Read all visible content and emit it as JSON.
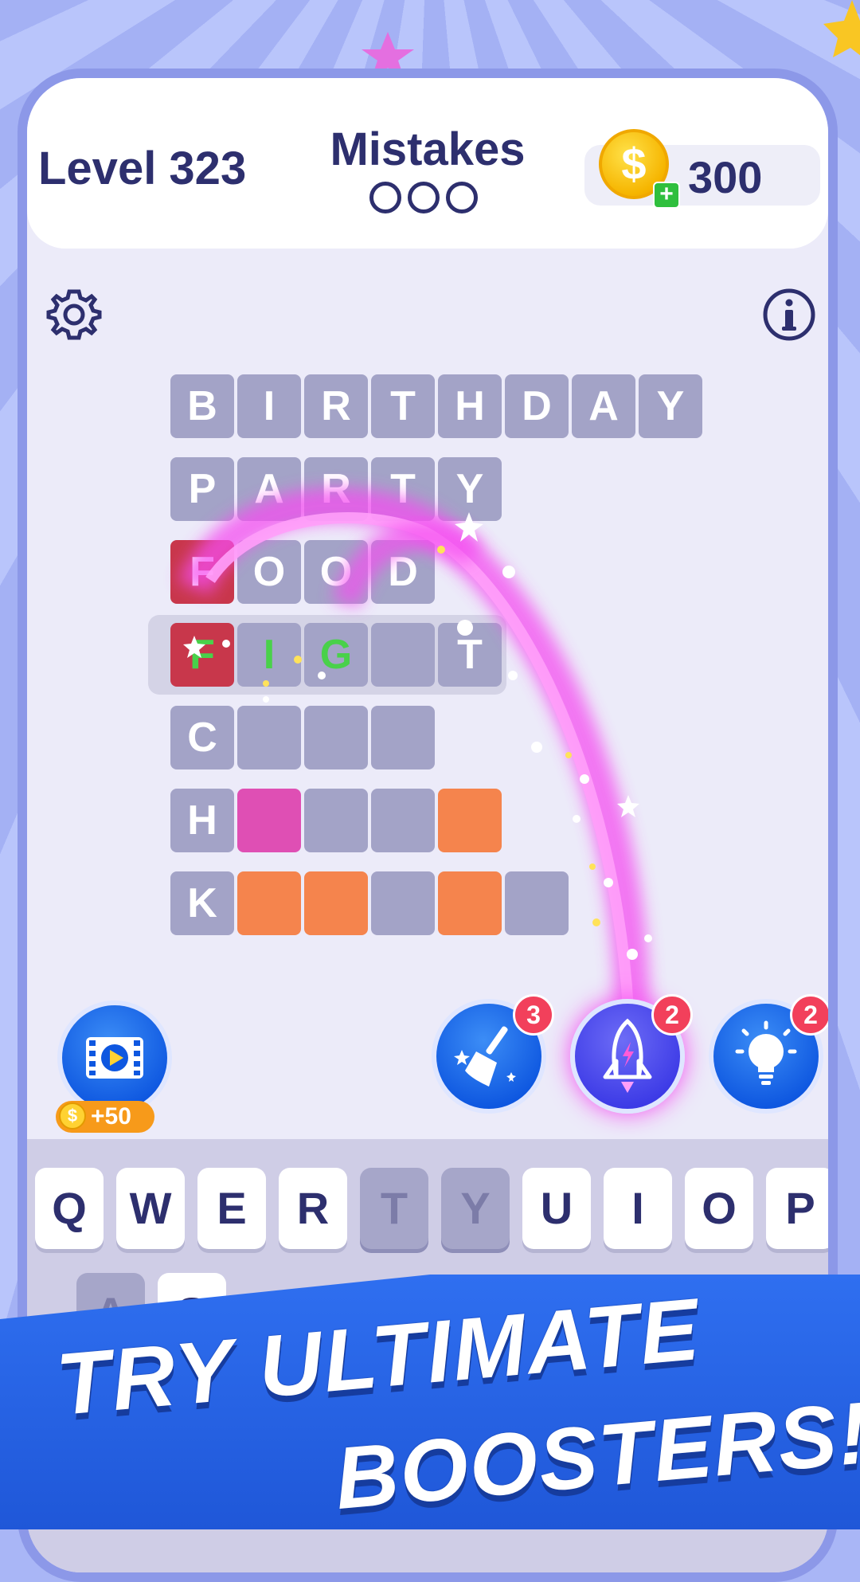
{
  "header": {
    "level_label": "Level 323",
    "mistakes_title": "Mistakes",
    "mistakes_used": 0,
    "mistakes_total": 3,
    "coins": "300",
    "coin_symbol": "$",
    "add_coins_symbol": "+"
  },
  "toolbar": {
    "settings_icon": "gear-icon",
    "info_icon": "info-icon"
  },
  "board": {
    "rows": [
      {
        "tiles": [
          {
            "letter": "B",
            "state": "revealed"
          },
          {
            "letter": "I",
            "state": "revealed"
          },
          {
            "letter": "R",
            "state": "revealed"
          },
          {
            "letter": "T",
            "state": "revealed"
          },
          {
            "letter": "H",
            "state": "revealed"
          },
          {
            "letter": "D",
            "state": "revealed"
          },
          {
            "letter": "A",
            "state": "revealed"
          },
          {
            "letter": "Y",
            "state": "revealed"
          }
        ]
      },
      {
        "tiles": [
          {
            "letter": "P",
            "state": "revealed"
          },
          {
            "letter": "A",
            "state": "revealed"
          },
          {
            "letter": "R",
            "state": "revealed"
          },
          {
            "letter": "T",
            "state": "revealed"
          },
          {
            "letter": "Y",
            "state": "revealed"
          }
        ]
      },
      {
        "tiles": [
          {
            "letter": "F",
            "state": "red"
          },
          {
            "letter": "O",
            "state": "revealed"
          },
          {
            "letter": "O",
            "state": "revealed"
          },
          {
            "letter": "D",
            "state": "revealed"
          }
        ]
      },
      {
        "active": true,
        "tiles": [
          {
            "letter": "F",
            "state": "red-green"
          },
          {
            "letter": "I",
            "state": "green"
          },
          {
            "letter": "G",
            "state": "green"
          },
          {
            "letter": "",
            "state": "empty"
          },
          {
            "letter": "T",
            "state": "revealed"
          }
        ]
      },
      {
        "tiles": [
          {
            "letter": "C",
            "state": "revealed"
          },
          {
            "letter": "",
            "state": "empty"
          },
          {
            "letter": "",
            "state": "empty"
          },
          {
            "letter": "",
            "state": "empty"
          }
        ]
      },
      {
        "tiles": [
          {
            "letter": "H",
            "state": "revealed"
          },
          {
            "letter": "",
            "state": "pink"
          },
          {
            "letter": "",
            "state": "empty"
          },
          {
            "letter": "",
            "state": "empty"
          },
          {
            "letter": "",
            "state": "orange"
          }
        ]
      },
      {
        "tiles": [
          {
            "letter": "K",
            "state": "revealed"
          },
          {
            "letter": "",
            "state": "orange"
          },
          {
            "letter": "",
            "state": "orange"
          },
          {
            "letter": "",
            "state": "empty"
          },
          {
            "letter": "",
            "state": "orange"
          },
          {
            "letter": "",
            "state": "empty"
          }
        ]
      }
    ]
  },
  "boosters": {
    "video_reward": {
      "icon": "video-film-icon",
      "reward": "+50"
    },
    "sweep": {
      "icon": "broom-icon",
      "count": "3"
    },
    "rocket": {
      "icon": "rocket-icon",
      "count": "2"
    },
    "hint": {
      "icon": "lightbulb-icon",
      "count": "2"
    }
  },
  "keyboard": {
    "row1": [
      {
        "key": "Q",
        "used": false
      },
      {
        "key": "W",
        "used": false
      },
      {
        "key": "E",
        "used": false
      },
      {
        "key": "R",
        "used": false
      },
      {
        "key": "T",
        "used": true
      },
      {
        "key": "Y",
        "used": true
      },
      {
        "key": "U",
        "used": false
      },
      {
        "key": "I",
        "used": false
      },
      {
        "key": "O",
        "used": false
      },
      {
        "key": "P",
        "used": false
      }
    ],
    "row2_visible": [
      {
        "key": "A",
        "used": true
      },
      {
        "key": "S",
        "used": false
      }
    ]
  },
  "banner": {
    "line1": "TRY ULTIMATE",
    "line2": "BOOSTERS!"
  },
  "colors": {
    "background": "#a9b6f6",
    "card_border": "#8c98e8",
    "tile_gray": "#a3a3c7",
    "tile_red": "#c8374b",
    "tile_pink": "#df4fb4",
    "tile_orange": "#f5844d",
    "tile_green_text": "#49d14a",
    "banner_blue": "#2563e6",
    "booster_blue": "#0e57e0",
    "badge_red": "#f2405b",
    "sparkle_magenta": "#f44df0"
  }
}
